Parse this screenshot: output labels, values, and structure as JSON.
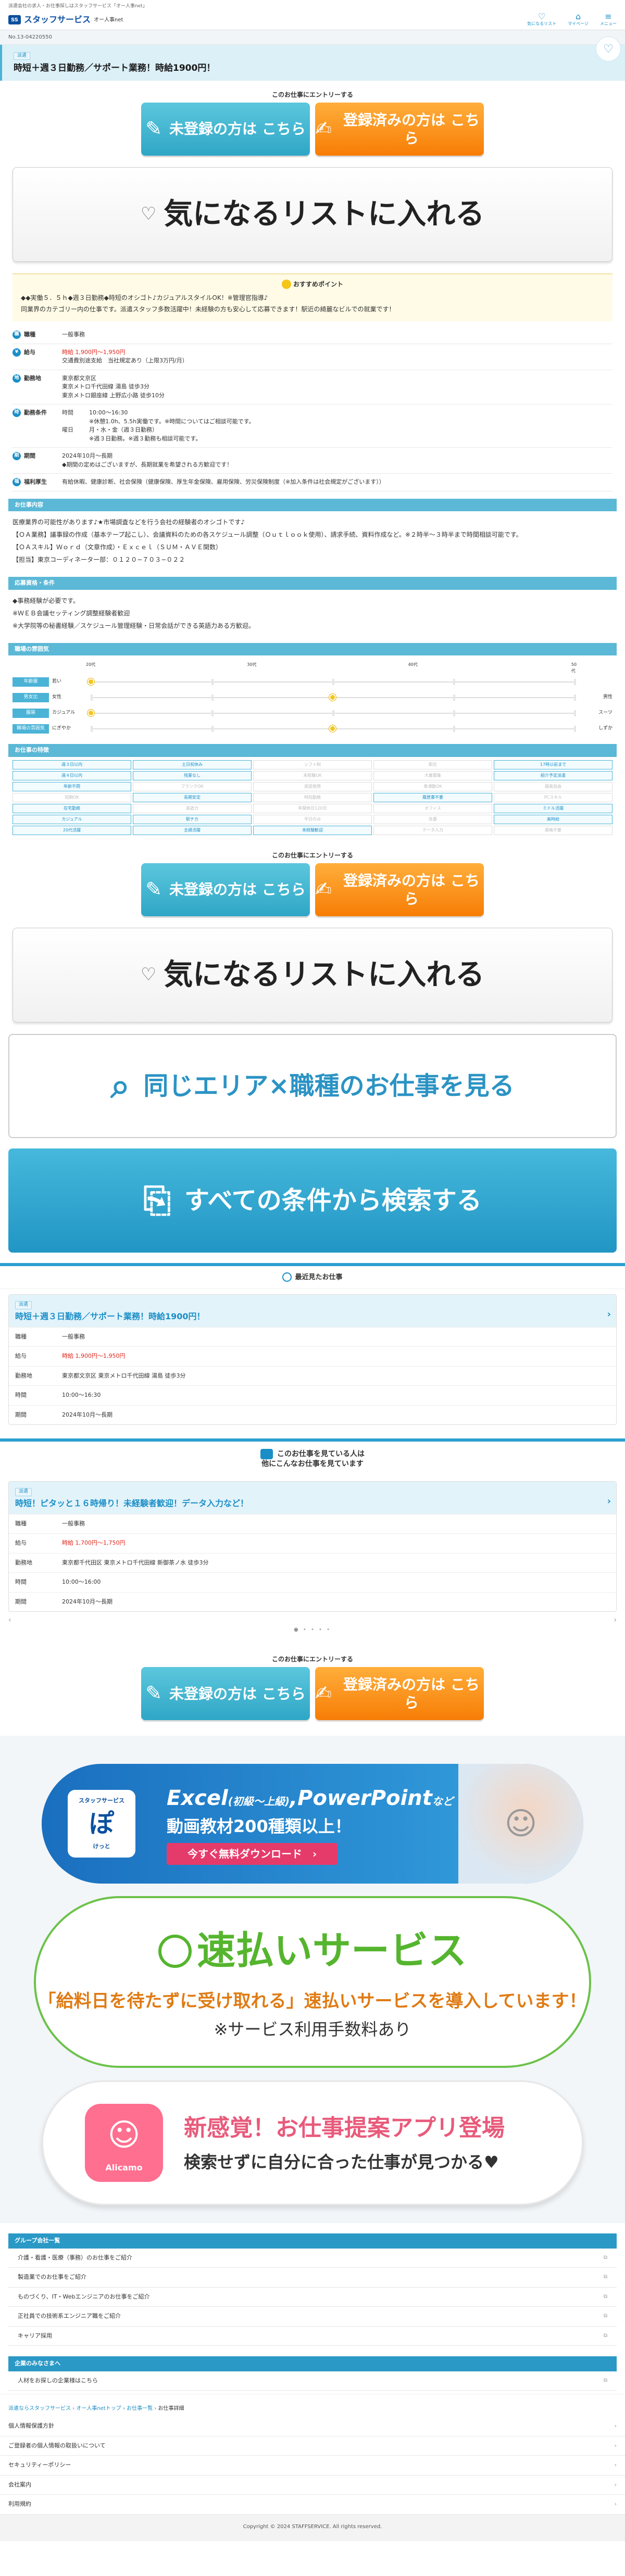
{
  "top_line": "派遣会社の求人・お仕事探しはスタッフサービス「オー人事net」",
  "header": {
    "logo_mark": "SS",
    "logo_text": "スタッフサービス",
    "logo_sub": "オー人事net",
    "icons": [
      {
        "glyph": "♡",
        "label": "気になるリスト"
      },
      {
        "glyph": "⌂",
        "label": "マイページ"
      },
      {
        "glyph": "≡",
        "label": "メニュー"
      }
    ]
  },
  "job_no": "No.13-04220550",
  "job": {
    "tag": "派遣",
    "title": "時短＋週３日勤務／サポート業務！時給1900円！"
  },
  "entry": {
    "label": "このお仕事にエントリーする",
    "new_btn": "未登録の方は こちら",
    "reg_btn": "登録済みの方は こちら"
  },
  "fav_btn": "気になるリストに入れる",
  "reco": {
    "head": "おすすめポイント",
    "lines": [
      "◆◆実働５．５ｈ◆週３日勤務◆時短のオシゴト♪カジュアルスタイルOK！※管理官指導♪",
      "同業界のカテゴリー内の仕事です。派遣スタッフ多数活躍中！未経験の方も安心して応募できます！駅近の綺麗なビルでの就業です！"
    ]
  },
  "details": [
    {
      "icon": "職",
      "label": "職種",
      "lines": [
        "一般事務"
      ]
    },
    {
      "icon": "¥",
      "label": "給与",
      "red": "時給 1,900円〜1,950円",
      "lines": [
        "交通費別途支給　当社規定あり（上限3万円/月）"
      ]
    },
    {
      "icon": "地",
      "label": "勤務地",
      "lines": [
        "東京都文京区",
        "東京メトロ千代田線 湯島 徒歩3分",
        "東京メトロ銀座線 上野広小路 徒歩10分"
      ]
    },
    {
      "icon": "時",
      "label": "勤務条件",
      "sub": [
        {
          "k": "時間",
          "v": [
            "10:00〜16:30",
            "※休憩1.0h、5.5h実働です。※時間についてはご相談可能です。"
          ]
        },
        {
          "k": "曜日",
          "v": [
            "月・水・金（週３日勤務）",
            "※週３日勤務。※週３勤務も相談可能です。"
          ]
        }
      ]
    },
    {
      "icon": "期",
      "label": "期間",
      "lines": [
        "2024年10月〜長期",
        "◆期間の定めはございますが、長期就業を希望される方歓迎です！"
      ]
    },
    {
      "icon": "福",
      "label": "福利厚生",
      "lines": [
        "有給休暇、健康診断、社会保険（健康保険、厚生年金保険、雇用保険、労災保険制度（※加入条件は社会規定がございます））"
      ]
    }
  ],
  "work_title": "お仕事内容",
  "work_lines": [
    "医療業界の可能性があります♪★市場調査などを行う会社の経験者のオシゴトです♪",
    "【ＯＡ業務】議事録の作成（基本テープ起こし）、会議資料のための各スケジュール調整（Ｏｕｔｌｏｏｋ使用）、請求手続、資料作成など。※２時半〜３時半まで時間相談可能です。",
    "【ＯＡスキル】Ｗｏｒｄ（文章作成）・Ｅｘｃｅｌ（ＳＵＭ・ＡＶＥ関数）",
    "【担当】東京コーディネーター部：０１２０−７０３−０２２"
  ],
  "req_title": "応募資格・条件",
  "req_lines": [
    "◆事務経験が必要です。",
    "※ＷＥＢ会議セッティング調整経験者歓迎",
    "※大学院等の秘書経験／スケジュール管理経験・日常会話ができる英語力ある方歓迎。"
  ],
  "mood_title": "職場の雰囲気",
  "mood": [
    {
      "label": "年齢層",
      "left": "若い",
      "right": "",
      "pos": 0.0
    },
    {
      "label": "男女比",
      "left": "女性",
      "right": "男性",
      "pos": 0.5
    },
    {
      "label": "服装",
      "left": "カジュアル",
      "right": "スーツ",
      "pos": 0.0
    },
    {
      "label": "職場の雰囲気",
      "left": "にぎやか",
      "right": "しずか",
      "pos": 0.5
    }
  ],
  "mood_ticks": [
    "20代",
    "30代",
    "40代",
    "50代"
  ],
  "attr_title": "お仕事の特徴",
  "attrs": [
    {
      "t": "週３日以内",
      "on": true
    },
    {
      "t": "土日祝休み",
      "on": true
    },
    {
      "t": "シフト制",
      "on": false
    },
    {
      "t": "駅近",
      "on": false
    },
    {
      "t": "17時以前まで",
      "on": true
    },
    {
      "t": "週４日以内",
      "on": true
    },
    {
      "t": "残業なし",
      "on": true
    },
    {
      "t": "未経験OK",
      "on": false
    },
    {
      "t": "大量募集",
      "on": false
    },
    {
      "t": "紹介予定派遣",
      "on": true
    },
    {
      "t": "年齢不問",
      "on": true
    },
    {
      "t": "ブランクOK",
      "on": false
    },
    {
      "t": "英語使用",
      "on": false
    },
    {
      "t": "車通勤OK",
      "on": false
    },
    {
      "t": "服装自由",
      "on": false
    },
    {
      "t": "短期OK",
      "on": false
    },
    {
      "t": "長期安定",
      "on": true
    },
    {
      "t": "時短勤務",
      "on": false
    },
    {
      "t": "履歴書不要",
      "on": true
    },
    {
      "t": "PCスキル",
      "on": false
    },
    {
      "t": "在宅勤務",
      "on": true
    },
    {
      "t": "英語力",
      "on": false
    },
    {
      "t": "年間休日120日",
      "on": false
    },
    {
      "t": "オフィス",
      "on": false
    },
    {
      "t": "ミドル活躍",
      "on": true
    },
    {
      "t": "カジュアル",
      "on": true
    },
    {
      "t": "駅チカ",
      "on": true
    },
    {
      "t": "平日のみ",
      "on": false
    },
    {
      "t": "急募",
      "on": false
    },
    {
      "t": "高時給",
      "on": true
    },
    {
      "t": "20代活躍",
      "on": true
    },
    {
      "t": "主婦活躍",
      "on": true
    },
    {
      "t": "未経験歓迎",
      "on": true
    },
    {
      "t": "データ入力",
      "on": false
    },
    {
      "t": "資格不要",
      "on": false
    }
  ],
  "area_btn": "同じエリア×職種のお仕事を見る",
  "search_btn": "すべての条件から検索する",
  "recent": {
    "head": "最近見たお仕事",
    "tag": "派遣",
    "title": "時短＋週３日勤務／サポート業務！時給1900円！",
    "rows": [
      {
        "k": "職種",
        "v": "一般事務",
        "red": false
      },
      {
        "k": "給与",
        "v": "時給 1,900円〜1,950円",
        "red": true
      },
      {
        "k": "勤務地",
        "v": "東京都文京区 東京メトロ千代田線 湯島 徒歩3分",
        "red": false
      },
      {
        "k": "時間",
        "v": "10:00〜16:30",
        "red": false
      },
      {
        "k": "期間",
        "v": "2024年10月〜長期",
        "red": false
      }
    ]
  },
  "others": {
    "head1": "このお仕事を見ている人は",
    "head2": "他にこんなお仕事を見ています",
    "tag": "派遣",
    "title": "時短！ピタッと１６時帰り！未経験者歓迎！データ入力など！",
    "rows": [
      {
        "k": "職種",
        "v": "一般事務",
        "red": false
      },
      {
        "k": "給与",
        "v": "時給 1,700円〜1,750円",
        "red": true
      },
      {
        "k": "勤務地",
        "v": "東京都千代田区 東京メトロ千代田線 新御茶ノ水 徒歩3分",
        "red": false
      },
      {
        "k": "時間",
        "v": "10:00〜16:00",
        "red": false
      },
      {
        "k": "期間",
        "v": "2024年10月〜長期",
        "red": false
      }
    ],
    "dots": "● • • • •",
    "prev": "‹",
    "next": "›"
  },
  "banner1": {
    "logo_top": "スタッフサービス",
    "logo_main": "ぽ",
    "logo_bottom": "けっと",
    "l1": "Excel",
    "l1b": "(初級〜上級)",
    "l1c": ",PowerPoint",
    "l1d": "など",
    "l2": "動画教材200種類以上！",
    "l3": "今すぐ無料ダウンロード　›"
  },
  "banner2": {
    "title": "速払いサービス",
    "sub": "「給料日を待たずに受け取れる」速払いサービスを導入しています！",
    "note": "※サービス利用手数料あり"
  },
  "banner3": {
    "logo": "Alicamo",
    "a": "新感覚！お仕事提案アプリ登場",
    "b": "検索せずに自分に合った仕事が見つかる♥"
  },
  "group": {
    "head": "グループ会社一覧",
    "items": [
      "介護・看護・医療（事務）のお仕事をご紹介",
      "製造業でのお仕事をご紹介",
      "ものづくり、IT・Webエンジニアのお仕事をご紹介",
      "正社員での技術系エンジニア職をご紹介",
      "キャリア採用"
    ]
  },
  "corp": {
    "head": "企業のみなさまへ",
    "items": [
      "人材をお探しの企業様はこちら"
    ]
  },
  "crumbs": [
    "派遣ならスタッフサービス",
    "オー人事netトップ",
    "お仕事一覧"
  ],
  "crumb_current": "お仕事詳細",
  "footer_links": [
    "個人情報保護方針",
    "ご登録者の個人情報の取扱いについて",
    "セキュリティーポリシー",
    "会社案内",
    "利用規約"
  ],
  "copyright": "Copyright © 2024 STAFFSERVICE. All rights reserved."
}
